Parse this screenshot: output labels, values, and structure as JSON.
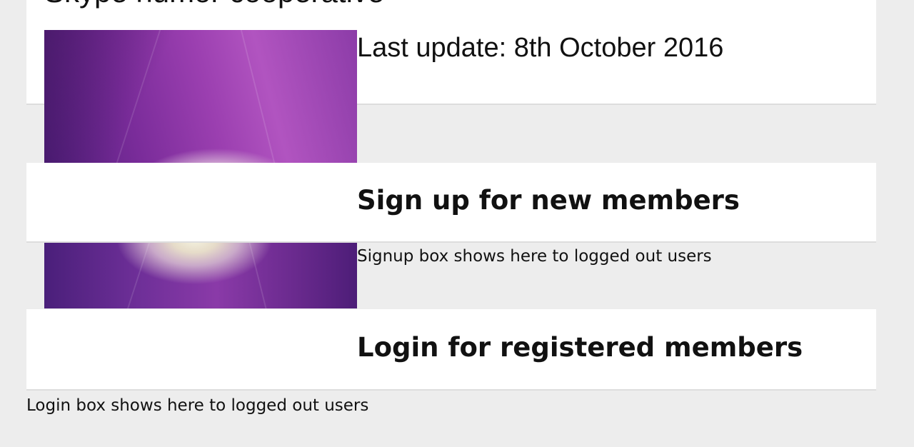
{
  "header": {
    "site_title": "Skype humor cooperative",
    "last_update": "Last update: 8th October 2016"
  },
  "signup": {
    "heading": "Sign up for new members",
    "note": "Signup box shows here to logged out users"
  },
  "login": {
    "heading": "Login for registered members",
    "note": "Login box shows here to logged out users"
  },
  "colors": {
    "background": "#ededed",
    "panel": "#ffffff",
    "flower_purple": "#8c3ca8"
  }
}
